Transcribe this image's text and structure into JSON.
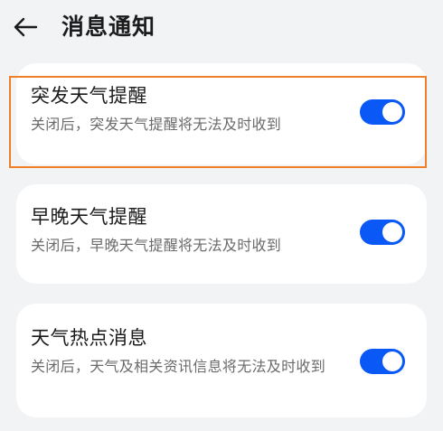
{
  "header": {
    "title": "消息通知",
    "back_icon": "arrow-left-icon"
  },
  "settings": [
    {
      "title": "突发天气提醒",
      "description": "关闭后，突发天气提醒将无法及时收到",
      "enabled": true
    },
    {
      "title": "早晚天气提醒",
      "description": "关闭后，早晚天气提醒将无法及时收到",
      "enabled": true
    },
    {
      "title": "天气热点消息",
      "description": "关闭后，天气及相关资讯信息将无法及时收到",
      "enabled": true
    }
  ],
  "colors": {
    "accent": "#0a59f7",
    "highlight": "#f07f2a",
    "background": "#f1f3f5"
  }
}
